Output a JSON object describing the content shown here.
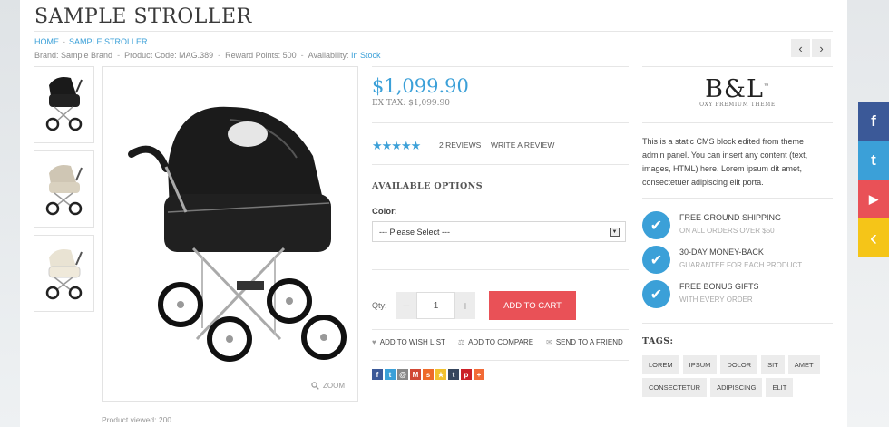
{
  "title": "SAMPLE STROLLER",
  "breadcrumb": {
    "home": "HOME",
    "sep": "-",
    "current": "SAMPLE STROLLER"
  },
  "meta": {
    "brand": "Brand: Sample Brand",
    "code": "Product Code: MAG.389",
    "reward": "Reward Points: 500",
    "availability_label": "Availability:",
    "availability_value": "In Stock",
    "sep": "-"
  },
  "nav": {
    "prev": "‹",
    "next": "›"
  },
  "zoom_label": "ZOOM",
  "viewed": "Product viewed: 200",
  "price": "$1,099.90",
  "extax": "EX TAX: $1,099.90",
  "rating": {
    "stars": 5,
    "stars_text": "★★★★★",
    "reviews": "2 REVIEWS",
    "write": "WRITE A REVIEW"
  },
  "options": {
    "heading": "AVAILABLE OPTIONS",
    "color_label": "Color:",
    "select_value": "--- Please Select ---"
  },
  "cart": {
    "qty_label": "Qty:",
    "minus": "−",
    "qty": "1",
    "plus": "+",
    "add": "ADD TO CART"
  },
  "actions": {
    "wishlist": "ADD TO WISH LIST",
    "compare": "ADD TO COMPARE",
    "friend": "SEND TO A FRIEND"
  },
  "logo": {
    "mark": "B&L",
    "tm": "™",
    "sub": "OXY PREMIUM THEME"
  },
  "cms_text": "This is a static CMS block edited from theme admin panel. You can insert any content (text, images, HTML) here. Lorem ipsum dit amet, consectetuer adipiscing elit porta.",
  "features": [
    {
      "title": "FREE GROUND SHIPPING",
      "sub": "ON ALL ORDERS OVER $50"
    },
    {
      "title": "30-DAY MONEY-BACK",
      "sub": "GUARANTEE FOR EACH PRODUCT"
    },
    {
      "title": "FREE BONUS GIFTS",
      "sub": "WITH EVERY ORDER"
    }
  ],
  "tags_heading": "TAGS:",
  "tags": [
    "LOREM",
    "IPSUM",
    "DOLOR",
    "SIT",
    "AMET",
    "CONSECTETUR",
    "ADIPISCING",
    "ELIT"
  ],
  "social": [
    {
      "name": "facebook",
      "glyph": "f",
      "color": "#3b5998"
    },
    {
      "name": "twitter",
      "glyph": "t",
      "color": "#3ba0d8"
    },
    {
      "name": "youtube",
      "glyph": "▶",
      "color": "#e95157"
    },
    {
      "name": "collapse",
      "glyph": "‹",
      "color": "#f5c518"
    }
  ],
  "colors": {
    "accent": "#3ba0d8",
    "cart": "#e95157"
  }
}
